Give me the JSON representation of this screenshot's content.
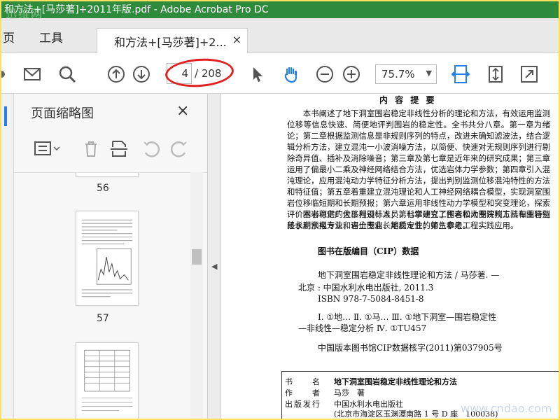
{
  "window": {
    "title": "和方法+[马莎著]+2011年版.pdf - Adobe Acrobat Pro DC",
    "watermark_top": "迅维网",
    "watermark_bottom": "www.cndao.com"
  },
  "menu": {
    "items": [
      "页",
      "工具"
    ],
    "active_tab": "和方法+[马莎著]+2...",
    "tab_close": "×"
  },
  "toolbar": {
    "icons": [
      "mail-icon",
      "search-icon",
      "page-up-icon",
      "page-down-icon",
      "select-arrow-icon",
      "hand-icon",
      "zoom-out-icon",
      "zoom-in-icon",
      "fit-width-icon",
      "fit-page-icon",
      "fullscreen-icon"
    ],
    "page_current": "4",
    "page_total": "/ 208",
    "zoom": "75.7%",
    "highlight_color": "#e02020",
    "accent_color": "#2680eb"
  },
  "panel": {
    "title": "页面缩略图",
    "close": "×",
    "tools": [
      "options-icon",
      "delete-icon",
      "insert-page-icon",
      "undo-rotate-icon",
      "redo-rotate-icon"
    ],
    "thumbnails": [
      {
        "label": "56"
      },
      {
        "label": "57"
      },
      {
        "label": ""
      }
    ]
  },
  "document": {
    "heading": "内 容 提 要",
    "para1": "本书阐述了地下洞室围岩稳定非线性分析的理论和方法，有效运用监测位移等信息快速、简便地评判围岩的稳定性。全书共分八章。第一章为绪论；第二章根据监测信息是非规则序列的特点，改进未确知滤波法，结合逻辑分析方法，建立混沌一小波消噪方法，以简便、快速对无规则序列进行剔除奇异值、插补及消除噪音；第三章及第七章是近年来的研究成果；第三章运用了偏最小二乘及神经网络结合方法，优选岩体力学参数；第四章引入混沌理论，应用混沌动力学特征分析方法，提出判别监测位移混沌特性的方法和特征值；第五章着重建立混沌理论和人工神经网络耦合模型，实现洞室围岩位移临短期和长期预报；第六章运用非线性动力学模型和突变理论，探索评价围岩稳定的位移判别标准；第七章建立了围岩松动圈评判方法和围岩位移长期预报方法，评价围岩长期稳定性；第八章是工程实践应用。",
    "para2": "本书可供广大工程设计人员、科学研究工作者和大专院校工科专业特别是水利水电专业和岩土专业、地质专业的师生参考。",
    "cip_title": "图书在版编目（CIP）数据",
    "cip1": "地下洞室围岩稳定非线性理论和方法 / 马莎著. —",
    "cip2": "北京 : 中国水利水电出版社, 2011.3",
    "cip3": "ISBN 978-7-5084-8451-8",
    "cip4": "Ⅰ. ①地… Ⅱ. ①马… Ⅲ. ①地下洞室—围岩稳定性",
    "cip5": "—非线性—稳定分析 Ⅳ. ①TU457",
    "cip6": "中国版本图书馆CIP数据核字(2011)第037905号",
    "table": [
      {
        "key": "书　　名",
        "value": "地下洞室围岩稳定非线性理论和方法"
      },
      {
        "key": "作　　者",
        "value": "马莎　著"
      },
      {
        "key": "出版发行",
        "value": "中国水利水电出版社"
      },
      {
        "key": "",
        "value": "(北京市海淀区玉渊潭南路 1 号 D 座　100038)"
      }
    ]
  }
}
